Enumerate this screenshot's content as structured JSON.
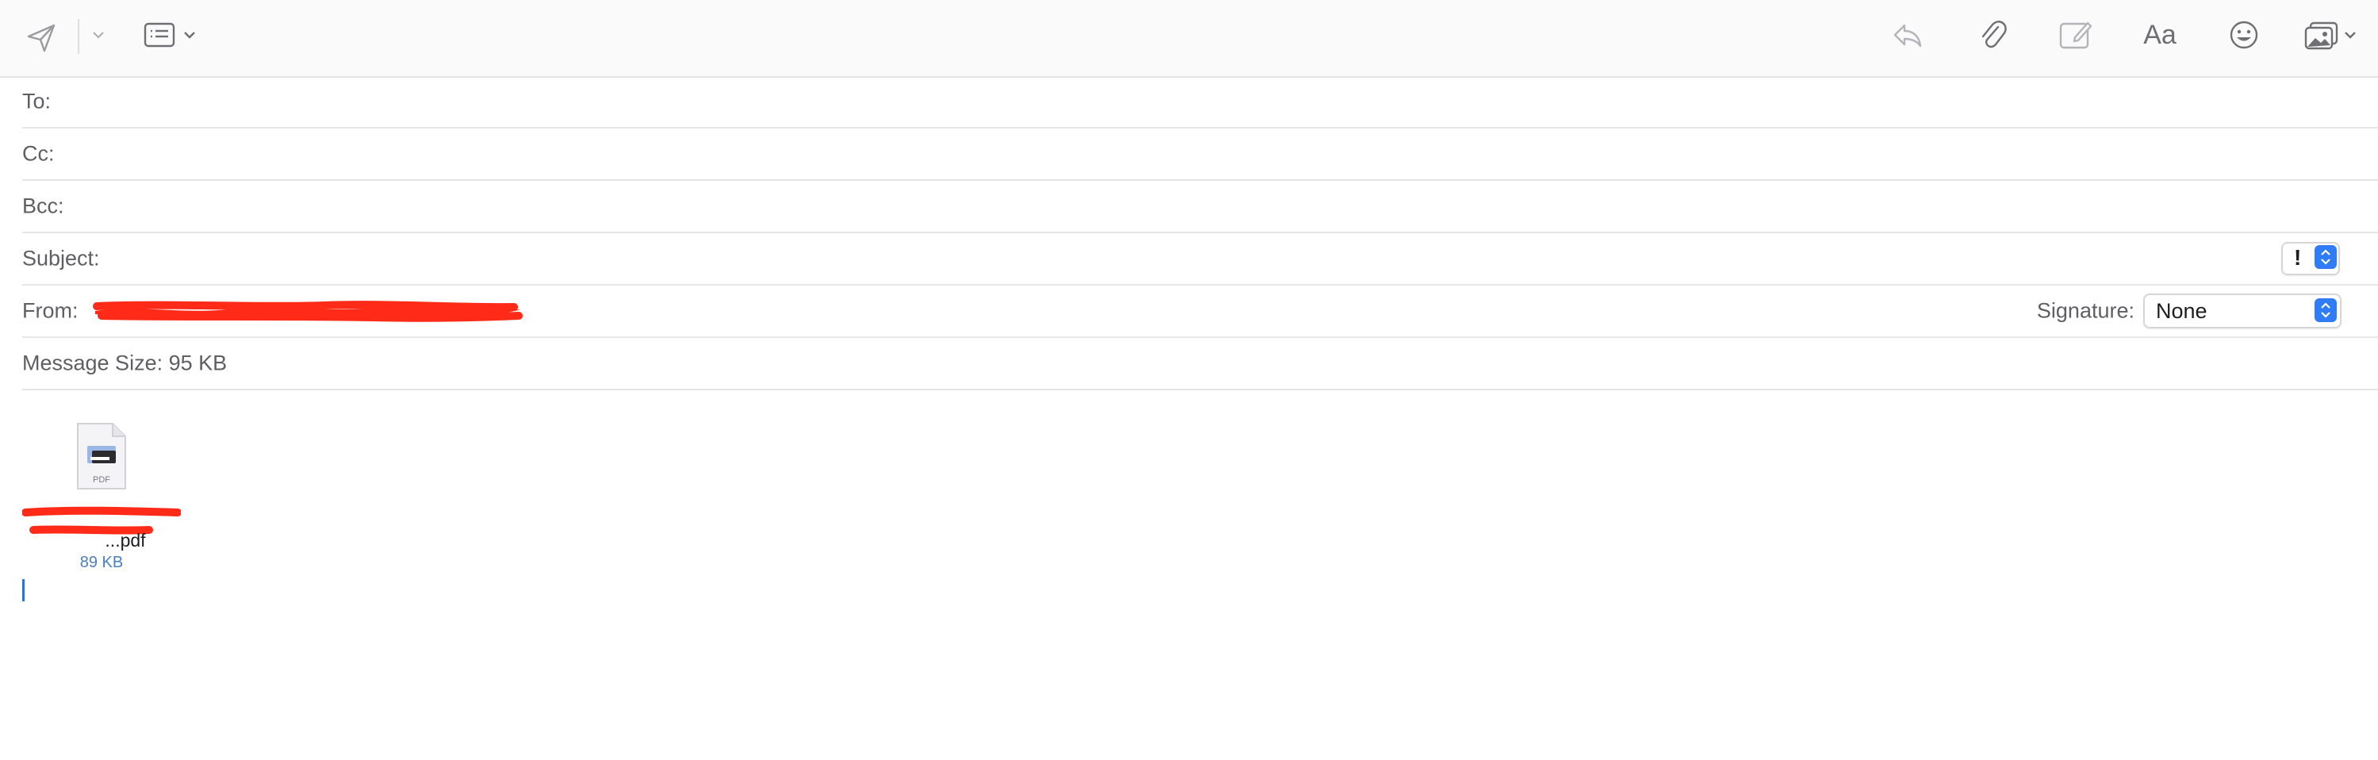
{
  "toolbar": {
    "send_icon": "paper-plane-icon",
    "send_options_icon": "chevron-down-icon",
    "header_fields_icon": "list-icon",
    "reply_icon": "reply-arrow-icon",
    "attach_icon": "paperclip-icon",
    "markup_icon": "markup-icon",
    "format_label": "Aa",
    "emoji_icon": "smiley-icon",
    "photo_browser_icon": "photo-icon"
  },
  "fields": {
    "to_label": "To:",
    "to_value": "",
    "cc_label": "Cc:",
    "cc_value": "",
    "bcc_label": "Bcc:",
    "bcc_value": "",
    "subject_label": "Subject:",
    "subject_value": "",
    "priority_symbol": "!",
    "from_label": "From:",
    "signature_label": "Signature:",
    "signature_value": "None",
    "message_size": "Message Size: 95 KB"
  },
  "attachment": {
    "icon": "pdf-file-icon",
    "icon_caption": "PDF",
    "name_line1": "",
    "name_line2": "...pdf",
    "size": "89 KB"
  },
  "colors": {
    "accent": "#2f7cf6",
    "redaction": "#ff2a17"
  }
}
